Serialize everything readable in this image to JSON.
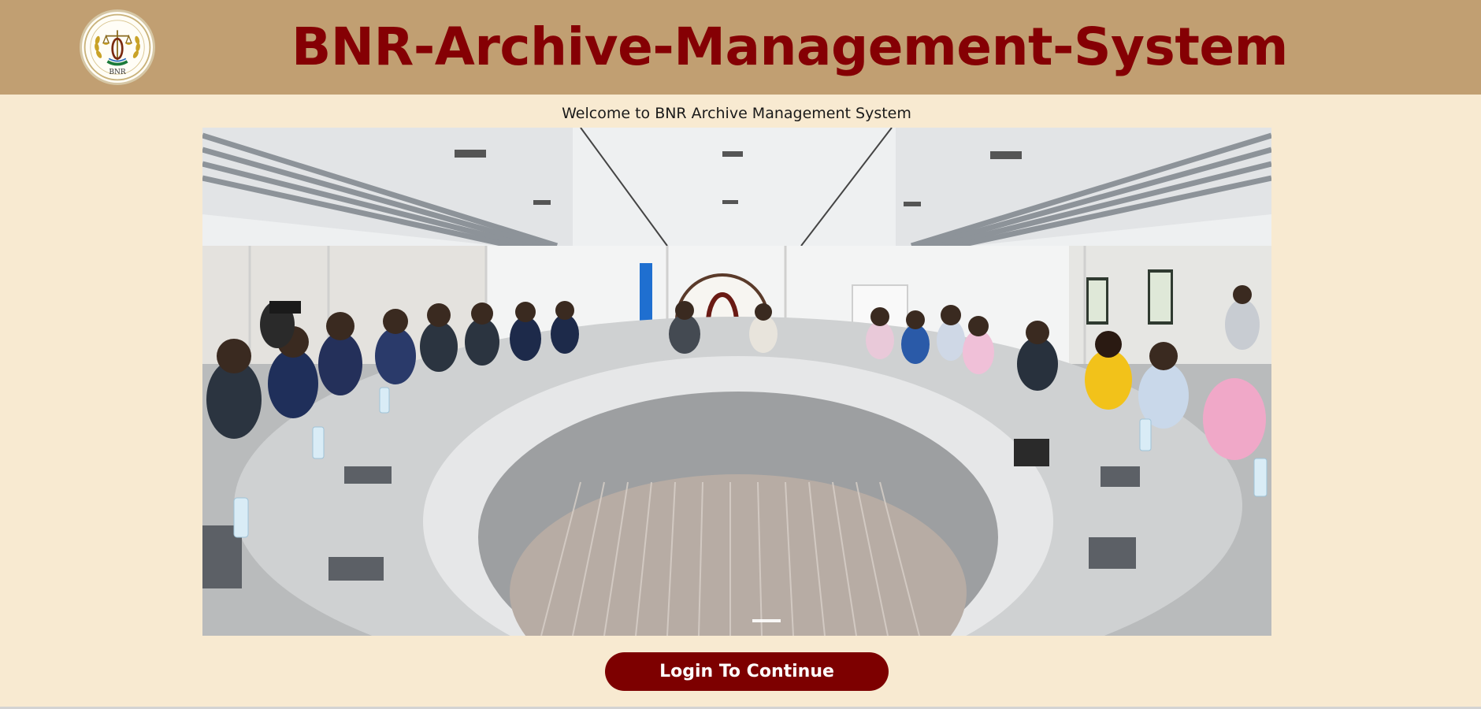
{
  "header": {
    "logo_icon": "bnr-emblem-icon",
    "logo_text": "BNR",
    "title": "BNR-Archive-Management-System",
    "background": "#c19f72",
    "title_color": "#850004"
  },
  "main": {
    "welcome_text": "Welcome to BNR Archive Management System",
    "hero_image": "boardroom-meeting-photo",
    "background": "#f8ead1"
  },
  "actions": {
    "login_label": "Login To Continue",
    "login_color": "#7d0000"
  }
}
